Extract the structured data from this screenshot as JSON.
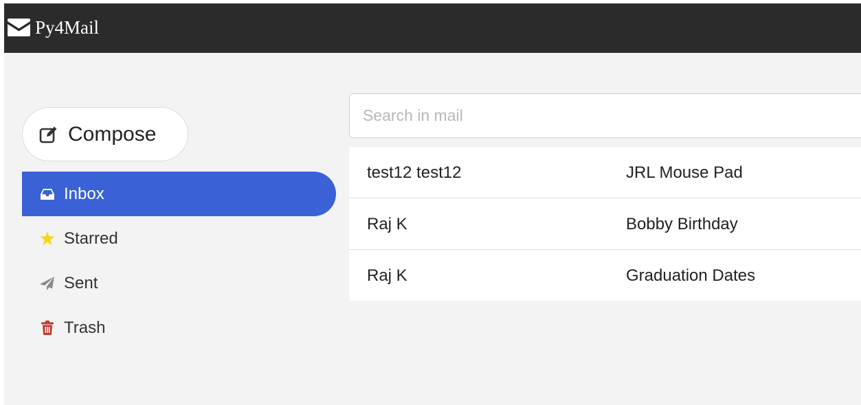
{
  "app": {
    "title": "Py4Mail",
    "icon": "envelope-icon"
  },
  "colors": {
    "topbar": "#2b2b2b",
    "background": "#f3f3f3",
    "accent": "#3a62d6",
    "star": "#f7d51d",
    "sent_icon": "#8a8a8a",
    "trash_icon": "#c0392b"
  },
  "compose": {
    "label": "Compose",
    "icon": "edit-icon"
  },
  "sidebar": {
    "items": [
      {
        "label": "Inbox",
        "icon": "inbox-icon",
        "active": true
      },
      {
        "label": "Starred",
        "icon": "star-icon",
        "active": false
      },
      {
        "label": "Sent",
        "icon": "paper-plane-icon",
        "active": false
      },
      {
        "label": "Trash",
        "icon": "trash-icon",
        "active": false
      }
    ]
  },
  "search": {
    "placeholder": "Search in mail",
    "value": ""
  },
  "mail": {
    "rows": [
      {
        "sender": "test12 test12",
        "subject": "JRL Mouse Pad"
      },
      {
        "sender": "Raj K",
        "subject": "Bobby Birthday"
      },
      {
        "sender": "Raj K",
        "subject": "Graduation Dates"
      }
    ]
  }
}
